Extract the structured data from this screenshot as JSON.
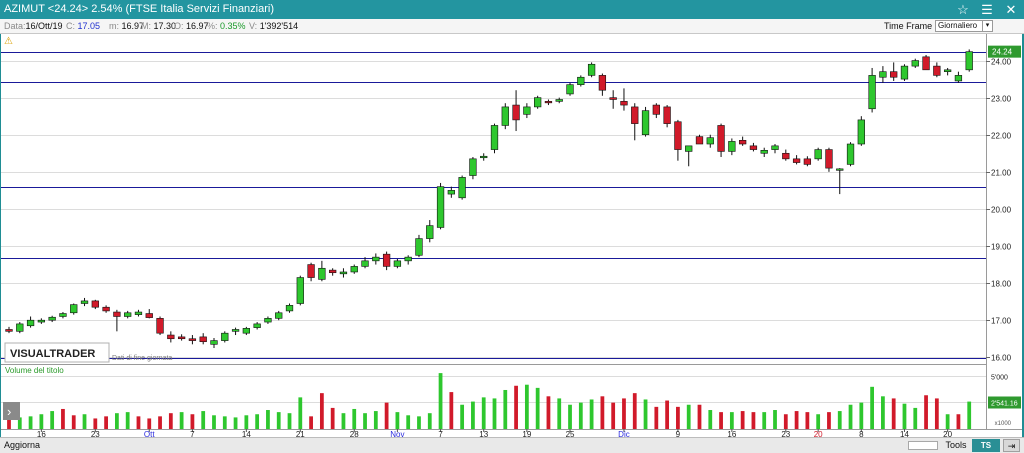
{
  "window": {
    "title": "AZIMUT <24.24> 2.54%  (FTSE Italia Servizi Finanziari)",
    "controls": [
      "☆",
      "☰",
      "✕"
    ]
  },
  "info": {
    "data_label": "Data:",
    "data_value": "16/Ott/19",
    "c_label": "C:",
    "c_value": "17.05",
    "m_label": "m:",
    "m_value": "16.97",
    "mx_label": "M:",
    "mx_value": "17.30",
    "o_label": "O:",
    "o_value": "16.97",
    "pct_label": "%:",
    "pct_value": "0.35%",
    "v_label": "V:",
    "v_value": "1'392'514",
    "timeframe_label": "Time Frame",
    "timeframe_value": "Giornaliero"
  },
  "watermark": {
    "brand": "VISUALTRADER",
    "note": "Dati di fine giornata"
  },
  "status": {
    "aggiorna": "Aggiorna",
    "tools": "Tools",
    "tsoff": "TS OFF"
  },
  "colors": {
    "up": "#2ec72e",
    "down": "#d11a2a",
    "hline": "#1a1a9a",
    "last_price_bg": "#2f9a2f",
    "volume_label": "#2a9a2a",
    "month_label": "#2a2adf",
    "special_label": "#d11a2a"
  },
  "chart_data": [
    {
      "type": "candlestick",
      "title": "",
      "ylim": [
        15.9,
        24.5
      ],
      "y_ticks": [
        "24.00",
        "23.00",
        "22.00",
        "21.00",
        "20.00",
        "19.00",
        "18.00",
        "17.00",
        "16.00"
      ],
      "last_price": "24.24",
      "horizontal_lines": [
        24.24,
        23.42,
        20.6,
        18.68,
        15.98
      ],
      "ohlc": [
        [
          16.75,
          16.82,
          16.65,
          16.7
        ],
        [
          16.7,
          16.95,
          16.65,
          16.9
        ],
        [
          16.85,
          17.1,
          16.8,
          17.0
        ],
        [
          16.95,
          17.05,
          16.9,
          17.0
        ],
        [
          17.0,
          17.12,
          16.95,
          17.08
        ],
        [
          17.1,
          17.22,
          17.05,
          17.18
        ],
        [
          17.2,
          17.45,
          17.15,
          17.42
        ],
        [
          17.45,
          17.6,
          17.38,
          17.52
        ],
        [
          17.52,
          17.55,
          17.3,
          17.35
        ],
        [
          17.35,
          17.4,
          17.2,
          17.25
        ],
        [
          17.22,
          17.28,
          16.7,
          17.1
        ],
        [
          17.1,
          17.25,
          17.05,
          17.2
        ],
        [
          17.15,
          17.28,
          17.1,
          17.22
        ],
        [
          17.18,
          17.3,
          17.05,
          17.07
        ],
        [
          17.05,
          17.1,
          16.6,
          16.65
        ],
        [
          16.6,
          16.7,
          16.4,
          16.5
        ],
        [
          16.55,
          16.62,
          16.45,
          16.5
        ],
        [
          16.5,
          16.6,
          16.35,
          16.45
        ],
        [
          16.55,
          16.65,
          16.35,
          16.42
        ],
        [
          16.35,
          16.52,
          16.25,
          16.45
        ],
        [
          16.45,
          16.7,
          16.4,
          16.65
        ],
        [
          16.7,
          16.8,
          16.6,
          16.75
        ],
        [
          16.65,
          16.82,
          16.6,
          16.78
        ],
        [
          16.8,
          16.95,
          16.75,
          16.9
        ],
        [
          16.95,
          17.1,
          16.9,
          17.05
        ],
        [
          17.05,
          17.25,
          17.0,
          17.2
        ],
        [
          17.25,
          17.45,
          17.2,
          17.4
        ],
        [
          17.45,
          18.2,
          17.4,
          18.15
        ],
        [
          18.5,
          18.55,
          18.05,
          18.15
        ],
        [
          18.1,
          18.6,
          18.05,
          18.4
        ],
        [
          18.35,
          18.4,
          18.2,
          18.28
        ],
        [
          18.25,
          18.4,
          18.15,
          18.3
        ],
        [
          18.3,
          18.5,
          18.25,
          18.45
        ],
        [
          18.45,
          18.7,
          18.4,
          18.6
        ],
        [
          18.6,
          18.8,
          18.5,
          18.7
        ],
        [
          18.78,
          18.85,
          18.35,
          18.45
        ],
        [
          18.45,
          18.65,
          18.4,
          18.6
        ],
        [
          18.6,
          18.75,
          18.5,
          18.7
        ],
        [
          18.75,
          19.3,
          18.7,
          19.2
        ],
        [
          19.2,
          19.7,
          19.1,
          19.55
        ],
        [
          19.5,
          20.7,
          19.45,
          20.6
        ],
        [
          20.4,
          20.6,
          20.3,
          20.5
        ],
        [
          20.3,
          20.9,
          20.25,
          20.85
        ],
        [
          20.9,
          21.4,
          20.8,
          21.35
        ],
        [
          21.4,
          21.5,
          21.3,
          21.42
        ],
        [
          21.6,
          22.3,
          21.5,
          22.25
        ],
        [
          22.25,
          22.85,
          22.15,
          22.75
        ],
        [
          22.8,
          23.2,
          22.1,
          22.4
        ],
        [
          22.55,
          22.85,
          22.45,
          22.75
        ],
        [
          22.75,
          23.05,
          22.7,
          23.0
        ],
        [
          22.9,
          22.95,
          22.8,
          22.88
        ],
        [
          22.9,
          23.0,
          22.85,
          22.95
        ],
        [
          23.1,
          23.4,
          23.05,
          23.35
        ],
        [
          23.35,
          23.6,
          23.3,
          23.55
        ],
        [
          23.6,
          23.95,
          23.55,
          23.9
        ],
        [
          23.6,
          23.65,
          23.05,
          23.2
        ],
        [
          23.0,
          23.2,
          22.7,
          22.95
        ],
        [
          22.9,
          23.25,
          22.65,
          22.8
        ],
        [
          22.75,
          22.85,
          21.85,
          22.3
        ],
        [
          22.0,
          22.75,
          21.95,
          22.65
        ],
        [
          22.8,
          22.85,
          22.45,
          22.55
        ],
        [
          22.75,
          22.8,
          22.2,
          22.3
        ],
        [
          22.35,
          22.4,
          21.3,
          21.6
        ],
        [
          21.55,
          21.65,
          21.15,
          21.7
        ],
        [
          21.95,
          22.0,
          21.75,
          21.75
        ],
        [
          21.75,
          22.0,
          21.65,
          21.92
        ],
        [
          22.25,
          22.3,
          21.4,
          21.55
        ],
        [
          21.55,
          21.9,
          21.45,
          21.82
        ],
        [
          21.85,
          21.95,
          21.7,
          21.75
        ],
        [
          21.7,
          21.78,
          21.55,
          21.6
        ],
        [
          21.5,
          21.65,
          21.4,
          21.58
        ],
        [
          21.6,
          21.75,
          21.5,
          21.7
        ],
        [
          21.5,
          21.6,
          21.3,
          21.35
        ],
        [
          21.35,
          21.45,
          21.2,
          21.25
        ],
        [
          21.35,
          21.42,
          21.15,
          21.2
        ],
        [
          21.35,
          21.65,
          21.3,
          21.6
        ],
        [
          21.6,
          21.65,
          21.0,
          21.1
        ],
        [
          21.05,
          21.1,
          20.4,
          21.08
        ],
        [
          21.2,
          21.8,
          21.15,
          21.75
        ],
        [
          21.75,
          22.5,
          21.7,
          22.4
        ],
        [
          22.7,
          23.8,
          22.6,
          23.6
        ],
        [
          23.55,
          23.85,
          23.4,
          23.7
        ],
        [
          23.7,
          23.95,
          23.45,
          23.55
        ],
        [
          23.5,
          23.9,
          23.45,
          23.85
        ],
        [
          23.85,
          24.05,
          23.8,
          24.0
        ],
        [
          24.1,
          24.15,
          23.75,
          23.75
        ],
        [
          23.85,
          23.95,
          23.55,
          23.6
        ],
        [
          23.7,
          23.8,
          23.6,
          23.75
        ],
        [
          23.45,
          23.7,
          23.4,
          23.6
        ],
        [
          23.75,
          24.3,
          23.7,
          24.24
        ]
      ]
    },
    {
      "type": "bar",
      "title": "Volume del titolo",
      "y_ticks": [
        "5'000",
        "2'541.16"
      ],
      "multiplier": "x1000",
      "values": [
        1700,
        1100,
        1200,
        1400,
        1700,
        1900,
        1300,
        1400,
        1000,
        1200,
        1500,
        1600,
        1200,
        1000,
        1200,
        1500,
        1600,
        1400,
        1700,
        1300,
        1200,
        1100,
        1300,
        1400,
        1800,
        1600,
        1500,
        3000,
        1200,
        3400,
        2000,
        1500,
        1900,
        1500,
        1700,
        2500,
        1600,
        1300,
        1200,
        1500,
        5300,
        3500,
        2300,
        2600,
        3000,
        2900,
        3700,
        4100,
        4200,
        3900,
        3100,
        2900,
        2300,
        2500,
        2800,
        3100,
        2500,
        2900,
        3400,
        2800,
        2100,
        2700,
        2100,
        2300,
        2300,
        1800,
        1600,
        1600,
        1700,
        1600,
        1600,
        1800,
        1400,
        1700,
        1600,
        1400,
        1600,
        1700,
        2300,
        2500,
        4000,
        3100,
        2900,
        2400,
        2000,
        3200,
        2900,
        1400,
        1400,
        2600
      ],
      "dir": [
        "d",
        "u",
        "u",
        "u",
        "u",
        "d",
        "d",
        "u",
        "d",
        "d",
        "u",
        "u",
        "d",
        "d",
        "d",
        "d",
        "u",
        "d",
        "u",
        "u",
        "u",
        "u",
        "u",
        "u",
        "u",
        "u",
        "u",
        "u",
        "d",
        "d",
        "d",
        "u",
        "u",
        "u",
        "u",
        "d",
        "u",
        "u",
        "u",
        "u",
        "u",
        "d",
        "u",
        "u",
        "u",
        "u",
        "u",
        "d",
        "u",
        "u",
        "d",
        "u",
        "u",
        "u",
        "u",
        "d",
        "d",
        "d",
        "d",
        "u",
        "d",
        "d",
        "d",
        "u",
        "d",
        "u",
        "d",
        "u",
        "d",
        "d",
        "u",
        "u",
        "d",
        "d",
        "d",
        "u",
        "d",
        "u",
        "u",
        "u",
        "u",
        "u",
        "d",
        "u",
        "u",
        "d",
        "d",
        "u",
        "d",
        "u"
      ]
    }
  ],
  "x_axis": {
    "labels": [
      {
        "text": "16",
        "kind": "day",
        "index": 3
      },
      {
        "text": "23",
        "kind": "day",
        "index": 8
      },
      {
        "text": "Ott",
        "kind": "month",
        "index": 13
      },
      {
        "text": "7",
        "kind": "day",
        "index": 17
      },
      {
        "text": "14",
        "kind": "day",
        "index": 22
      },
      {
        "text": "21",
        "kind": "day",
        "index": 27
      },
      {
        "text": "28",
        "kind": "day",
        "index": 32
      },
      {
        "text": "Nov",
        "kind": "month",
        "index": 36
      },
      {
        "text": "7",
        "kind": "day",
        "index": 40
      },
      {
        "text": "13",
        "kind": "day",
        "index": 44
      },
      {
        "text": "19",
        "kind": "day",
        "index": 48
      },
      {
        "text": "25",
        "kind": "day",
        "index": 52
      },
      {
        "text": "Dic",
        "kind": "month",
        "index": 57
      },
      {
        "text": "9",
        "kind": "day",
        "index": 62
      },
      {
        "text": "16",
        "kind": "day",
        "index": 67
      },
      {
        "text": "23",
        "kind": "day",
        "index": 72
      },
      {
        "text": "20",
        "kind": "special",
        "index": 75
      },
      {
        "text": "8",
        "kind": "day",
        "index": 79
      },
      {
        "text": "14",
        "kind": "day",
        "index": 83
      },
      {
        "text": "20",
        "kind": "day",
        "index": 87
      }
    ]
  }
}
